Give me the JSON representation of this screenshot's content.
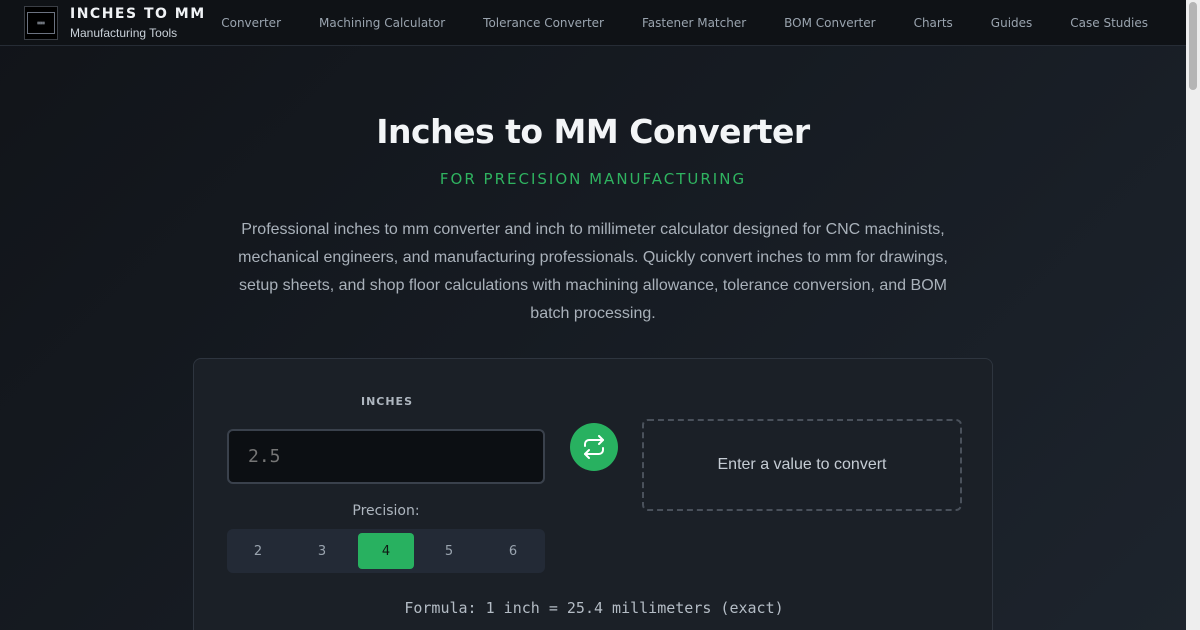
{
  "nav": {
    "brand_title": "INCHES TO MM",
    "brand_subtitle": "Manufacturing Tools",
    "links": [
      "Converter",
      "Machining Calculator",
      "Tolerance Converter",
      "Fastener Matcher",
      "BOM Converter",
      "Charts",
      "Guides",
      "Case Studies"
    ]
  },
  "hero": {
    "title": "Inches to MM Converter",
    "subtitle": "FOR PRECISION MANUFACTURING",
    "description": "Professional inches to mm converter and inch to millimeter calculator designed for CNC machinists, mechanical engineers, and manufacturing professionals. Quickly convert inches to mm for drawings, setup sheets, and shop floor calculations with machining allowance, tolerance conversion, and BOM batch processing."
  },
  "converter": {
    "input_label": "INCHES",
    "input_placeholder": "2.5",
    "swap_icon": "swap-arrows-icon",
    "result_text": "Enter a value to convert",
    "precision_label": "Precision:",
    "precision_options": [
      "2",
      "3",
      "4",
      "5",
      "6"
    ],
    "precision_selected": "4",
    "formula": "Formula: 1 inch = 25.4 millimeters (exact)"
  },
  "colors": {
    "accent": "#28b160",
    "background": "#14181e",
    "card": "#1b2027"
  }
}
